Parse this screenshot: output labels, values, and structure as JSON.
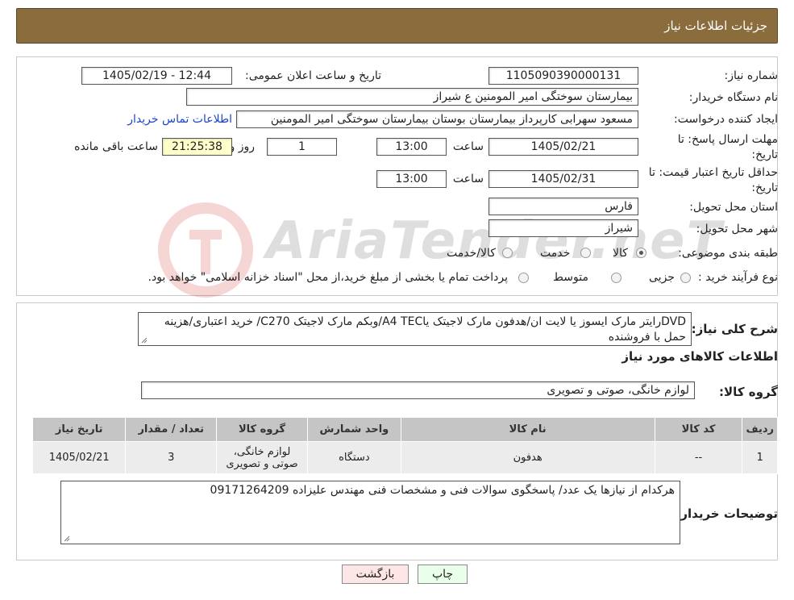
{
  "header": {
    "title": "جزئیات اطلاعات نیاز"
  },
  "form": {
    "need_number": {
      "label": "شماره نیاز:",
      "value": "1105090390000131"
    },
    "announce_datetime": {
      "label": "تاریخ و ساعت اعلان عمومی:",
      "value": "1405/02/19 - 12:44"
    },
    "buyer_org": {
      "label": "نام دستگاه خریدار:",
      "value": "بیمارستان سوختگی امیر المومنین  ع  شیراز"
    },
    "requester": {
      "label": "ایجاد کننده درخواست:",
      "value": "مسعود سهرابی کارپرداز بیمارستان بوستان بیمارستان سوختگی امیر المومنین",
      "link": "اطلاعات تماس خریدار"
    },
    "deadline": {
      "label_line1": "مهلت ارسال پاسخ: تا",
      "label_line2": "تاریخ:",
      "date": "1405/02/21",
      "time_label": "ساعت",
      "time": "13:00",
      "days": "1",
      "days_label": "روز و",
      "remaining": "21:25:38",
      "remaining_label": "ساعت باقی مانده"
    },
    "price_validity": {
      "label_line1": "حداقل تاریخ اعتبار قیمت: تا",
      "label_line2": "تاریخ:",
      "date": "1405/02/31",
      "time_label": "ساعت",
      "time": "13:00"
    },
    "province": {
      "label": "استان محل تحویل:",
      "value": "فارس"
    },
    "city": {
      "label": "شهر محل تحویل:",
      "value": "شیراز"
    },
    "category": {
      "label": "طبقه بندی موضوعی:",
      "options": [
        "کالا",
        "خدمت",
        "کالا/خدمت"
      ],
      "selected": "کالا"
    },
    "purchase_type": {
      "label": "نوع فرآیند خرید :",
      "options": [
        "جزیی",
        "متوسط"
      ],
      "note": "پرداخت تمام یا بخشی از مبلغ خرید،از محل \"اسناد خزانه اسلامی\" خواهد بود."
    }
  },
  "watermark": {
    "text": "AriaTender.neT"
  },
  "description": {
    "label": "شرح کلی نیاز:",
    "value": "DVDرایتر مارک ایسوز یا لایت ان/هدفون مارک لاجیتک یاA4 TEC/وبکم مارک لاجیتک  C270/ خرید اعتباری/هزینه حمل با فروشنده"
  },
  "goods_info_title": "اطلاعات کالاهای مورد نیاز",
  "goods_group": {
    "label": "گروه کالا:",
    "value": "لوازم خانگی، صوتی و تصویری"
  },
  "table": {
    "headers": [
      "ردیف",
      "کد کالا",
      "نام کالا",
      "واحد شمارش",
      "گروه کالا",
      "تعداد / مقدار",
      "تاریخ نیاز"
    ],
    "rows": [
      [
        "1",
        "--",
        "هدفون",
        "دستگاه",
        "لوازم خانگی، صوتی و تصویری",
        "3",
        "1405/02/21"
      ]
    ]
  },
  "buyer_notes": {
    "label": "توضیحات خریدار:",
    "value": "هرکدام از نیازها یک عدد/ پاسخگوی سوالات فنی و مشخصات فنی مهندس علیزاده 09171264209"
  },
  "buttons": {
    "print": "چاپ",
    "back": "بازگشت"
  },
  "colors": {
    "header_bg": "#8b6d3d",
    "table_header_bg": "#c5c5c5",
    "remaining_bg": "#ffffcc"
  }
}
